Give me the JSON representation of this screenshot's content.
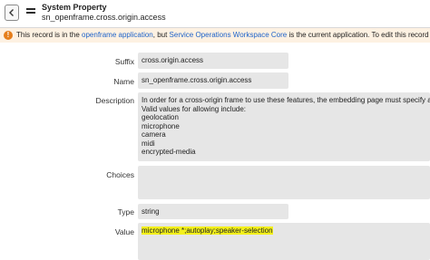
{
  "header": {
    "record_type": "System Property",
    "record_name": "sn_openframe.cross.origin.access"
  },
  "banner": {
    "icon": "exclamation-circle-icon",
    "text_1": "This record is in the ",
    "app_link": "openframe application",
    "text_2": ", but ",
    "current_app_link": "Service Operations Workspace Core",
    "text_3": " is the current application. To edit this record c"
  },
  "form": {
    "suffix_label": "Suffix",
    "suffix_value": "cross.origin.access",
    "name_label": "Name",
    "name_value": "sn_openframe.cross.origin.access",
    "description_label": "Description",
    "description_value": "In order for a cross-origin frame to use these features, the embedding page must specify a F\nValid values for allowing include:\ngeolocation\nmicrophone\ncamera\nmidi\nencrypted-media",
    "choices_label": "Choices",
    "choices_value": "",
    "type_label": "Type",
    "type_value": "string",
    "value_label": "Value",
    "value_value": "microphone *;autoplay;speaker-selection"
  },
  "colors": {
    "banner_bg": "#fdf1e2",
    "warning": "#e57e1b",
    "link": "#1e63c9",
    "highlight": "#f3f01c",
    "field_bg": "#e6e6e6"
  }
}
